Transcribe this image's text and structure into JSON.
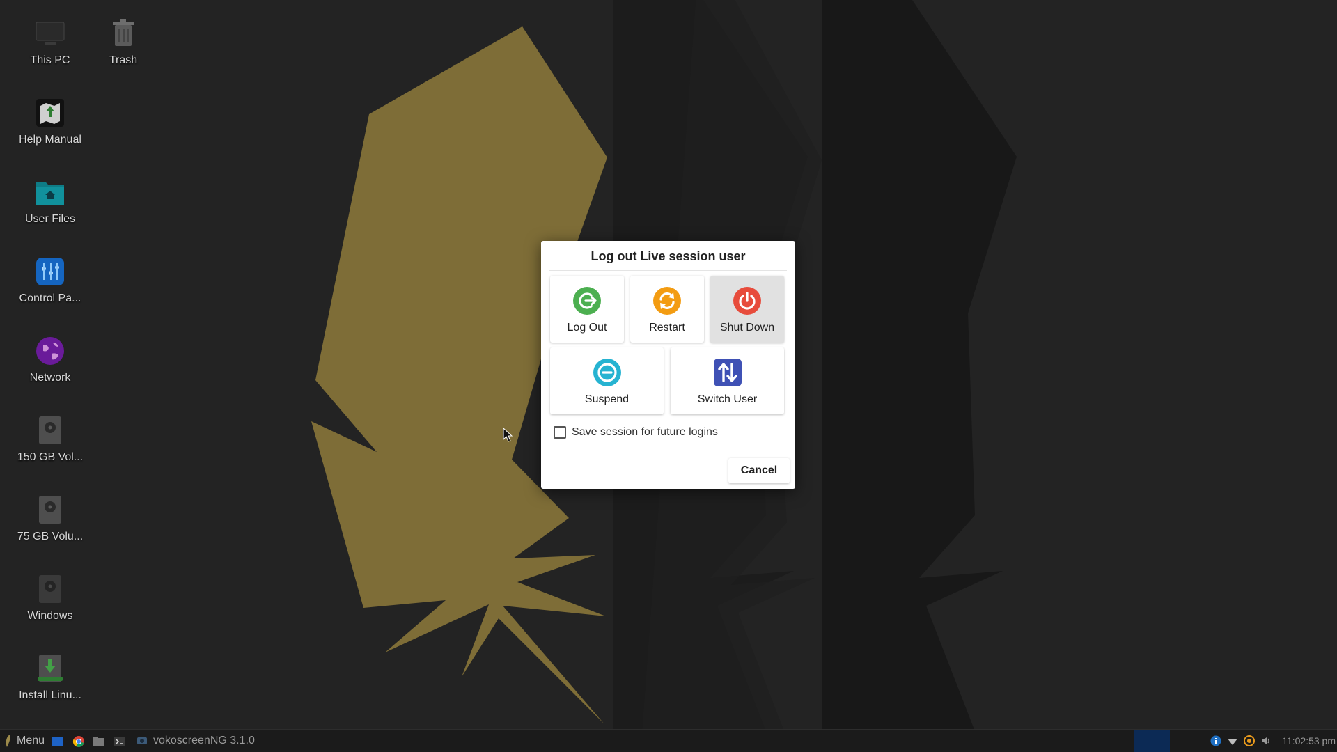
{
  "desktop": {
    "icons": [
      {
        "label": "This PC",
        "icon": "computer-icon"
      },
      {
        "label": "Trash",
        "icon": "trash-icon"
      },
      {
        "label": "Help Manual",
        "icon": "help-manual-icon"
      },
      {
        "label": "User Files",
        "icon": "home-folder-icon"
      },
      {
        "label": "Control Pa...",
        "icon": "control-panel-icon"
      },
      {
        "label": "Network",
        "icon": "network-globe-icon"
      },
      {
        "label": "150 GB Vol...",
        "icon": "drive-icon"
      },
      {
        "label": "75 GB Volu...",
        "icon": "drive-icon"
      },
      {
        "label": "Windows",
        "icon": "drive-icon"
      },
      {
        "label": "Install Linu...",
        "icon": "install-icon"
      }
    ]
  },
  "dialog": {
    "title": "Log out Live session user",
    "actions": {
      "logout": "Log Out",
      "restart": "Restart",
      "shutdown": "Shut Down",
      "suspend": "Suspend",
      "switch_user": "Switch User"
    },
    "save_session_label": "Save session for future logins",
    "save_session_checked": false,
    "cancel_label": "Cancel",
    "colors": {
      "logout": "#4caf50",
      "restart": "#f39c12",
      "shutdown": "#e74c3c",
      "suspend": "#26b3d1",
      "switch_user": "#3f51b5"
    }
  },
  "taskbar": {
    "menu_label": "Menu",
    "window_label": "vokoscreenNG 3.1.0",
    "clock": "11:02:53 pm",
    "workspace_color": "#0c2a55"
  }
}
